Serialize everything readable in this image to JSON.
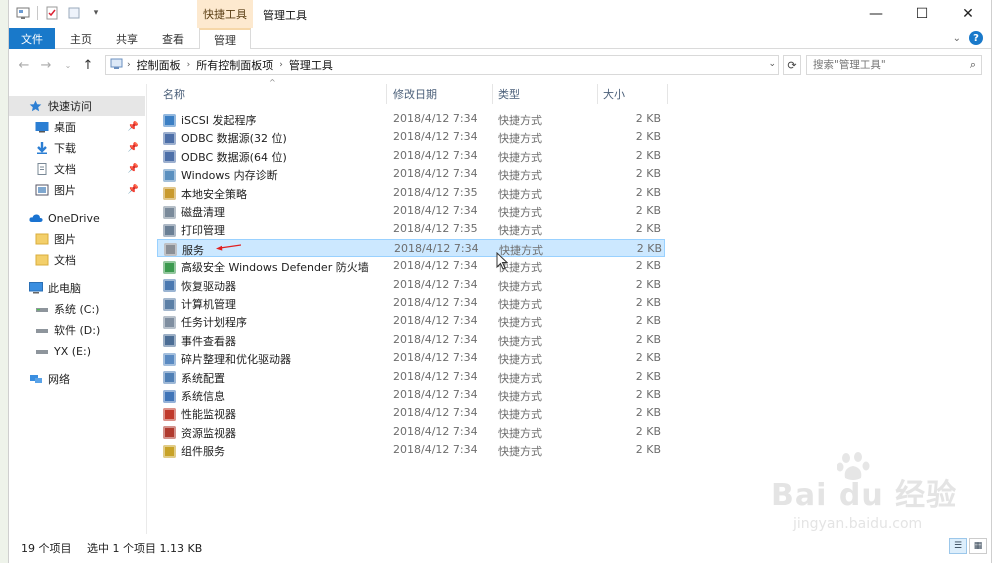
{
  "window": {
    "title": "管理工具",
    "context_tab": "快捷工具",
    "controls": {
      "minimize": "—",
      "maximize": "☐",
      "close": "✕"
    }
  },
  "ribbon": {
    "tabs": [
      "文件",
      "主页",
      "共享",
      "查看",
      "管理"
    ],
    "help": "?"
  },
  "address": {
    "crumbs": [
      "控制面板",
      "所有控制面板项",
      "管理工具"
    ],
    "search_placeholder": "搜索\"管理工具\""
  },
  "sidebar": {
    "items": [
      {
        "label": "快速访问",
        "level": 0,
        "icon": "star-icon",
        "selected": true
      },
      {
        "label": "桌面",
        "level": 1,
        "icon": "desktop-icon",
        "pinned": true
      },
      {
        "label": "下载",
        "level": 1,
        "icon": "download-icon",
        "pinned": true
      },
      {
        "label": "文档",
        "level": 1,
        "icon": "document-icon",
        "pinned": true
      },
      {
        "label": "图片",
        "level": 1,
        "icon": "picture-icon",
        "pinned": true
      },
      {
        "label": "OneDrive",
        "level": 0,
        "icon": "cloud-icon"
      },
      {
        "label": "图片",
        "level": 1,
        "icon": "folder-icon"
      },
      {
        "label": "文档",
        "level": 1,
        "icon": "folder-icon"
      },
      {
        "label": "此电脑",
        "level": 0,
        "icon": "computer-icon"
      },
      {
        "label": "系统 (C:)",
        "level": 1,
        "icon": "drive-icon"
      },
      {
        "label": "软件 (D:)",
        "level": 1,
        "icon": "drive-icon"
      },
      {
        "label": "YX (E:)",
        "level": 1,
        "icon": "drive-icon"
      },
      {
        "label": "网络",
        "level": 0,
        "icon": "network-icon"
      }
    ]
  },
  "columns": {
    "name": "名称",
    "date": "修改日期",
    "type": "类型",
    "size": "大小"
  },
  "files": [
    {
      "name": "iSCSI 发起程序",
      "date": "2018/4/12 7:34",
      "type": "快捷方式",
      "size": "2 KB",
      "color": "#3b7fc4"
    },
    {
      "name": "ODBC 数据源(32 位)",
      "date": "2018/4/12 7:34",
      "type": "快捷方式",
      "size": "2 KB",
      "color": "#4d6fa8"
    },
    {
      "name": "ODBC 数据源(64 位)",
      "date": "2018/4/12 7:34",
      "type": "快捷方式",
      "size": "2 KB",
      "color": "#4d6fa8"
    },
    {
      "name": "Windows 内存诊断",
      "date": "2018/4/12 7:34",
      "type": "快捷方式",
      "size": "2 KB",
      "color": "#5a8fbf"
    },
    {
      "name": "本地安全策略",
      "date": "2018/4/12 7:35",
      "type": "快捷方式",
      "size": "2 KB",
      "color": "#c99a2e"
    },
    {
      "name": "磁盘清理",
      "date": "2018/4/12 7:34",
      "type": "快捷方式",
      "size": "2 KB",
      "color": "#7a8a9a"
    },
    {
      "name": "打印管理",
      "date": "2018/4/12 7:35",
      "type": "快捷方式",
      "size": "2 KB",
      "color": "#6a7f95"
    },
    {
      "name": "服务",
      "date": "2018/4/12 7:34",
      "type": "快捷方式",
      "size": "2 KB",
      "color": "#8a8f96",
      "selected": true
    },
    {
      "name": "高级安全 Windows Defender 防火墙",
      "date": "2018/4/12 7:34",
      "type": "快捷方式",
      "size": "2 KB",
      "color": "#3c9a4f"
    },
    {
      "name": "恢复驱动器",
      "date": "2018/4/12 7:34",
      "type": "快捷方式",
      "size": "2 KB",
      "color": "#4a78b0"
    },
    {
      "name": "计算机管理",
      "date": "2018/4/12 7:34",
      "type": "快捷方式",
      "size": "2 KB",
      "color": "#5b7fa6"
    },
    {
      "name": "任务计划程序",
      "date": "2018/4/12 7:34",
      "type": "快捷方式",
      "size": "2 KB",
      "color": "#7f8ea0"
    },
    {
      "name": "事件查看器",
      "date": "2018/4/12 7:34",
      "type": "快捷方式",
      "size": "2 KB",
      "color": "#4b6d95"
    },
    {
      "name": "碎片整理和优化驱动器",
      "date": "2018/4/12 7:34",
      "type": "快捷方式",
      "size": "2 KB",
      "color": "#5a8ac2"
    },
    {
      "name": "系统配置",
      "date": "2018/4/12 7:34",
      "type": "快捷方式",
      "size": "2 KB",
      "color": "#4f7fb5"
    },
    {
      "name": "系统信息",
      "date": "2018/4/12 7:34",
      "type": "快捷方式",
      "size": "2 KB",
      "color": "#3f74b8"
    },
    {
      "name": "性能监视器",
      "date": "2018/4/12 7:34",
      "type": "快捷方式",
      "size": "2 KB",
      "color": "#c0392b"
    },
    {
      "name": "资源监视器",
      "date": "2018/4/12 7:34",
      "type": "快捷方式",
      "size": "2 KB",
      "color": "#b03a2e"
    },
    {
      "name": "组件服务",
      "date": "2018/4/12 7:34",
      "type": "快捷方式",
      "size": "2 KB",
      "color": "#c8a227"
    }
  ],
  "status": {
    "count": "19 个项目",
    "selection": "选中 1 个项目  1.13 KB"
  },
  "watermark": {
    "main": "Bai du 经验",
    "sub": "jingyan.baidu.com"
  },
  "colors": {
    "accent": "#1979ca",
    "selection_bg": "#cce8ff",
    "context_tab_bg": "#fde9cf"
  }
}
